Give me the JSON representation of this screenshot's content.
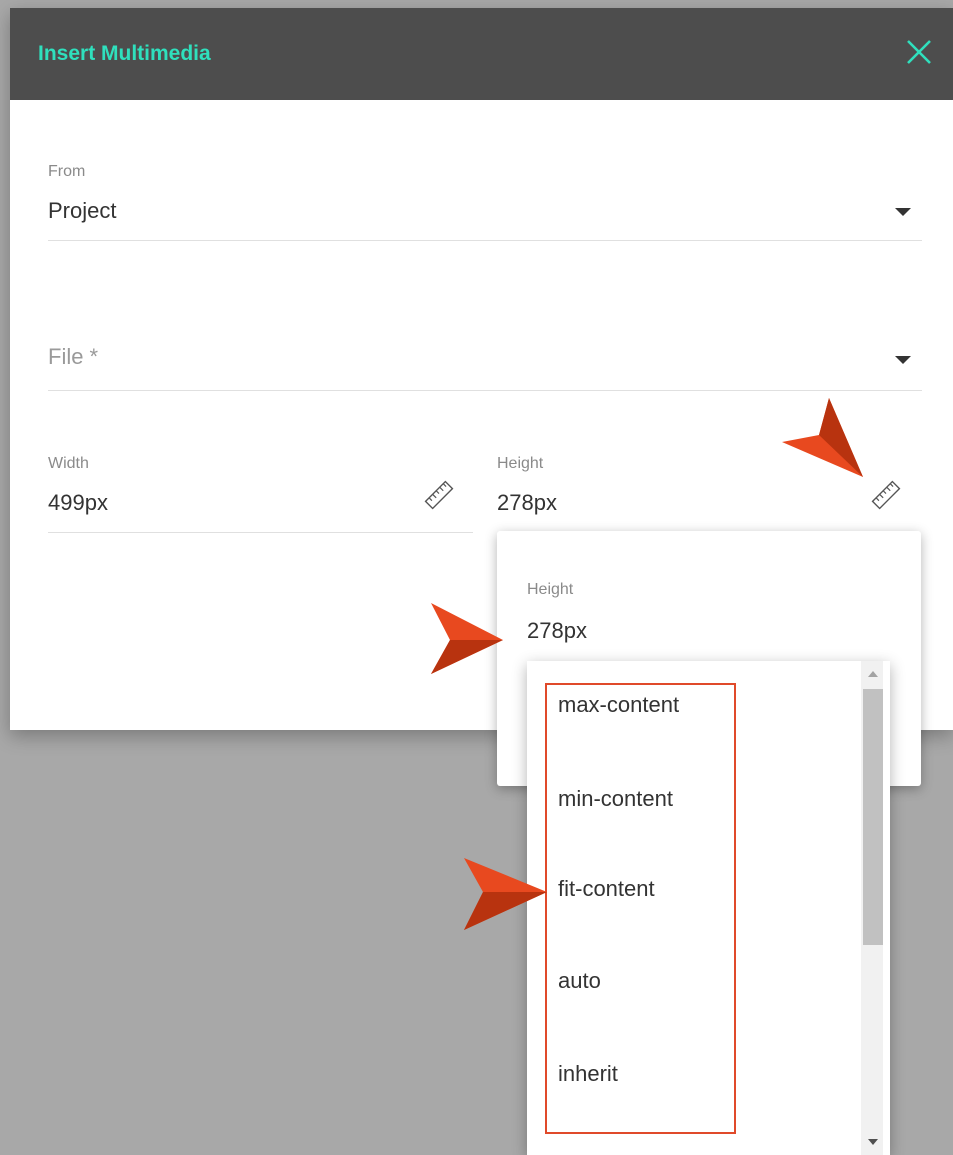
{
  "dialog": {
    "title": "Insert Multimedia",
    "close_icon": "close-icon",
    "accent_color": "#2fe0bd",
    "titlebar_color": "#4d4d4d"
  },
  "from_field": {
    "label": "From",
    "value": "Project"
  },
  "file_field": {
    "placeholder": "File *"
  },
  "width_field": {
    "label": "Width",
    "value": "499px",
    "icon": "ruler-icon"
  },
  "height_field": {
    "label": "Height",
    "value": "278px",
    "icon": "ruler-icon"
  },
  "height_popup": {
    "label": "Height",
    "value": "278px",
    "options": [
      "max-content",
      "min-content",
      "fit-content",
      "auto",
      "inherit"
    ]
  },
  "annotations": {
    "arrow_color": "#e8491f",
    "highlight_color": "#e04a2a"
  }
}
